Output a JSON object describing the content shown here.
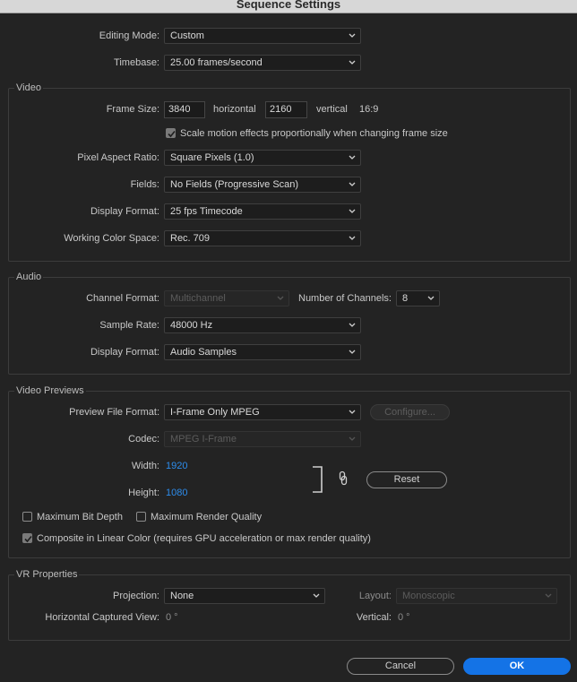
{
  "window": {
    "title": "Sequence Settings"
  },
  "general": {
    "editing_mode_label": "Editing Mode:",
    "editing_mode_value": "Custom",
    "timebase_label": "Timebase:",
    "timebase_value": "25.00  frames/second"
  },
  "video": {
    "legend": "Video",
    "frame_size_label": "Frame Size:",
    "frame_width": "3840",
    "horizontal_label": "horizontal",
    "frame_height": "2160",
    "vertical_label": "vertical",
    "aspect": "16:9",
    "scale_motion_label": "Scale motion effects proportionally when changing frame size",
    "scale_motion_checked": true,
    "pixel_aspect_label": "Pixel Aspect Ratio:",
    "pixel_aspect_value": "Square Pixels (1.0)",
    "fields_label": "Fields:",
    "fields_value": "No Fields (Progressive Scan)",
    "display_format_label": "Display Format:",
    "display_format_value": "25 fps Timecode",
    "color_space_label": "Working Color Space:",
    "color_space_value": "Rec. 709"
  },
  "audio": {
    "legend": "Audio",
    "channel_format_label": "Channel Format:",
    "channel_format_value": "Multichannel",
    "num_channels_label": "Number of Channels:",
    "num_channels_value": "8",
    "sample_rate_label": "Sample Rate:",
    "sample_rate_value": "48000 Hz",
    "display_format_label": "Display Format:",
    "display_format_value": "Audio Samples"
  },
  "previews": {
    "legend": "Video Previews",
    "file_format_label": "Preview File Format:",
    "file_format_value": "I-Frame Only MPEG",
    "configure_label": "Configure...",
    "codec_label": "Codec:",
    "codec_value": "MPEG I-Frame",
    "width_label": "Width:",
    "width_value": "1920",
    "height_label": "Height:",
    "height_value": "1080",
    "reset_label": "Reset",
    "max_bit_depth_label": "Maximum Bit Depth",
    "max_render_quality_label": "Maximum Render Quality",
    "composite_label": "Composite in Linear Color (requires GPU acceleration or max render quality)",
    "composite_checked": true
  },
  "vr": {
    "legend": "VR Properties",
    "projection_label": "Projection:",
    "projection_value": "None",
    "layout_label": "Layout:",
    "layout_value": "Monoscopic",
    "h_view_label": "Horizontal Captured View:",
    "h_view_value": "0 °",
    "vertical_label": "Vertical:",
    "vertical_value": "0 °"
  },
  "footer": {
    "cancel_label": "Cancel",
    "ok_label": "OK"
  },
  "colors": {
    "accent": "#1473e6",
    "link_blue": "#2d8ceb",
    "background": "#232323"
  }
}
